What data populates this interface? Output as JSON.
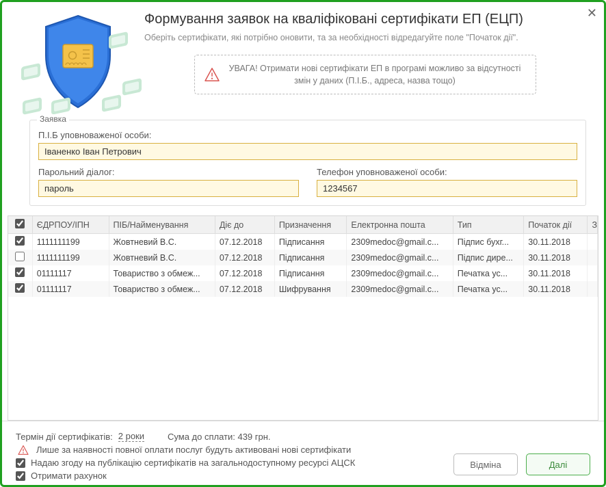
{
  "header": {
    "title": "Формування заявок на кваліфіковані сертифікати ЕП (ЕЦП)",
    "subtitle": "Оберіть сертифікати, які потрібно оновити, та за необхідності відредагуйте поле \"Початок дії\".",
    "warning": "УВАГА! Отримати нові сертифікати ЕП в програмі можливо за відсутності змін у даних (П.І.Б., адреса, назва тощо)"
  },
  "form": {
    "legend": "Заявка",
    "pib_label": "П.І.Б уповноваженої особи:",
    "pib_value": "Іваненко Іван Петрович",
    "pwd_label": "Парольний діалог:",
    "pwd_value": "пароль",
    "phone_label": "Телефон уповноваженої особи:",
    "phone_value": "1234567"
  },
  "table": {
    "headers": {
      "edrpou": "ЄДРПОУ/ІПН",
      "name": "ПІБ/Найменування",
      "valid_to": "Діє до",
      "purpose": "Призначення",
      "email": "Електронна пошта",
      "type": "Тип",
      "start": "Початок дії"
    },
    "rows": [
      {
        "checked": true,
        "edrpou": "1111111199",
        "name": "Жовтневий В.С.",
        "valid_to": "07.12.2018",
        "purpose": "Підписання",
        "email": "2309medoc@gmail.c...",
        "type": "Підпис бухг...",
        "start": "30.11.2018"
      },
      {
        "checked": false,
        "edrpou": "1111111199",
        "name": "Жовтневий В.С.",
        "valid_to": "07.12.2018",
        "purpose": "Підписання",
        "email": "2309medoc@gmail.c...",
        "type": "Підпис дире...",
        "start": "30.11.2018"
      },
      {
        "checked": true,
        "edrpou": "01111117",
        "name": "Товариство з обмеж...",
        "valid_to": "07.12.2018",
        "purpose": "Підписання",
        "email": "2309medoc@gmail.c...",
        "type": "Печатка ус...",
        "start": "30.11.2018"
      },
      {
        "checked": true,
        "edrpou": "01111117",
        "name": "Товариство з обмеж...",
        "valid_to": "07.12.2018",
        "purpose": "Шифрування",
        "email": "2309medoc@gmail.c...",
        "type": "Печатка ус...",
        "start": "30.11.2018"
      }
    ],
    "select_all_checked": true
  },
  "footer": {
    "term_label": "Термін дії сертифікатів:",
    "term_value": "2 роки",
    "sum_label": "Сума до сплати: 439 грн.",
    "payment_note": "Лише за наявності повної оплати послуг будуть активовані нові сертифікати",
    "consent_label": "Надаю згоду на публікацію сертифікатів на загальнодоступному ресурсі АЦСК",
    "invoice_label": "Отримати рахунок",
    "consent_checked": true,
    "invoice_checked": true,
    "cancel": "Відміна",
    "next": "Далі"
  }
}
